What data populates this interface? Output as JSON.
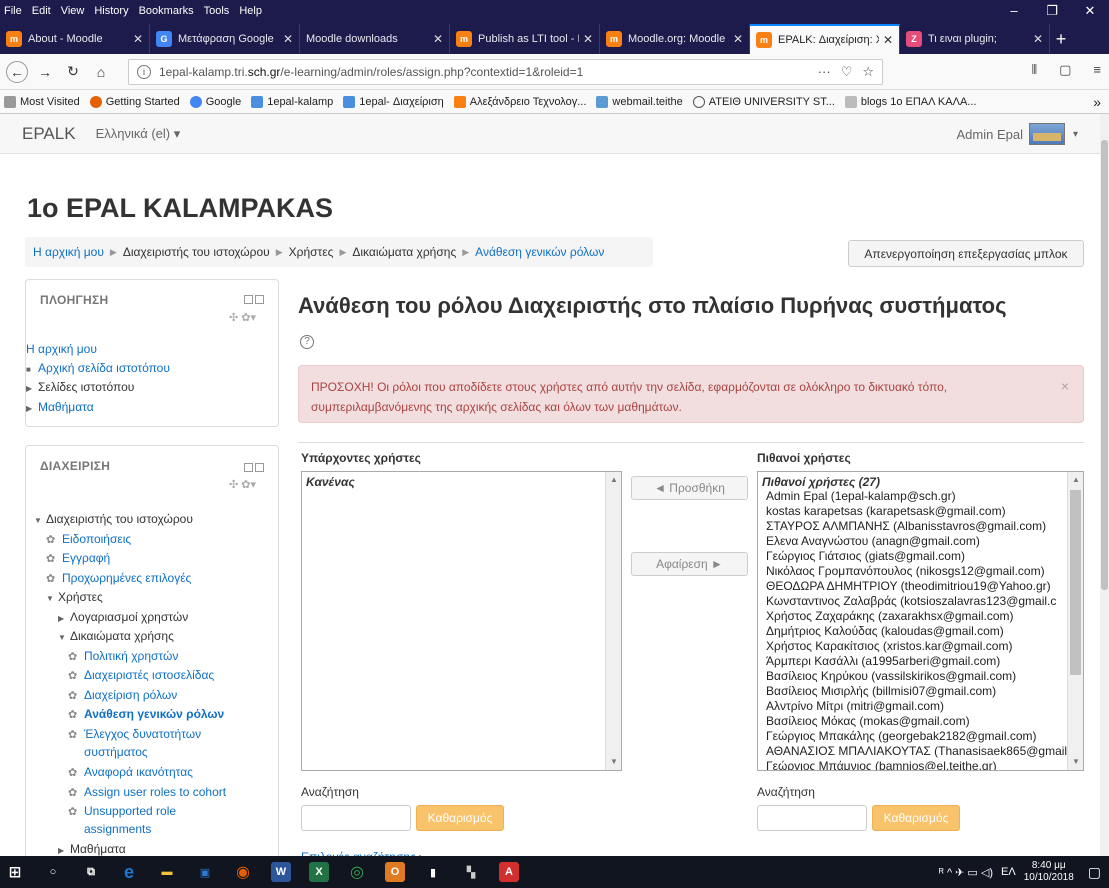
{
  "browser": {
    "menu": [
      "File",
      "Edit",
      "View",
      "History",
      "Bookmarks",
      "Tools",
      "Help"
    ],
    "window_controls": [
      "–",
      "❐",
      "✕"
    ],
    "tabs": [
      {
        "label": "About - Moodle",
        "color": "#f98012",
        "glyph": "m"
      },
      {
        "label": "Μετάφραση Google",
        "color": "#4285f4",
        "glyph": "G"
      },
      {
        "label": "Moodle downloads",
        "color": "",
        "glyph": ""
      },
      {
        "label": "Publish as LTI tool - M",
        "color": "#f98012",
        "glyph": "m"
      },
      {
        "label": "Moodle.org: Moodle S",
        "color": "#f98012",
        "glyph": "m"
      },
      {
        "label": "EPALK: Διαχείριση: Χρ",
        "color": "#f98012",
        "glyph": "m"
      },
      {
        "label": "Τι ειναι plugin;",
        "color": "#e44d7a",
        "glyph": "Z"
      }
    ],
    "new_tab": "+",
    "url_host": "1epal-kalamp.tri.",
    "url_domain": "sch.gr",
    "url_path": "/e-learning/admin/roles/assign.php?contextid=1&roleid=1",
    "url_icons": [
      "···",
      "♡",
      "☆"
    ],
    "nav_right_icons": [
      "⫴",
      "▢",
      "≡"
    ],
    "bookmarks": [
      {
        "label": "Most Visited",
        "color": "#999"
      },
      {
        "label": "Getting Started",
        "color": "#e66000"
      },
      {
        "label": "Google",
        "color": "#4285f4"
      },
      {
        "label": "1epal-kalamp",
        "color": "#4a8ee0"
      },
      {
        "label": "1epal- Διαχείριση",
        "color": "#4a8ee0"
      },
      {
        "label": "Αλεξάνδρειο Τεχνολογ...",
        "color": "#f98012"
      },
      {
        "label": "webmail.teithe",
        "color": "#5b9bd5"
      },
      {
        "label": "ΑΤΕΙΘ UNIVERSITY ST...",
        "color": "#555"
      },
      {
        "label": "blogs 1ο ΕΠΑΛ ΚΑΛΑ...",
        "color": "#bbb"
      }
    ],
    "bookmarks_more": "»"
  },
  "moodle": {
    "brand": "EPALK",
    "language": "Ελληνικά (el) ▾",
    "user_name": "Admin Epal",
    "user_caret": "▾",
    "site_title": "1ο EPAL KALAMPAKAS",
    "breadcrumb": [
      "Η αρχική μου",
      "Διαχειριστής του ιστοχώρου",
      "Χρήστες",
      "Δικαιώματα χρήσης",
      "Ανάθεση γενικών ρόλων"
    ],
    "breadcrumb_sep": "▶",
    "block_editing_button": "Απενεργοποίηση επεξεργασίας μπλοκ",
    "navigation_block": {
      "title": "ΠΛΟΗΓΗΣΗ",
      "controls": "✣ ✿▾",
      "items": [
        {
          "label": "Η αρχική μου"
        },
        {
          "label": "Αρχική σελίδα ιστοτόπου"
        },
        {
          "label": "Σελίδες ιστοτόπου"
        },
        {
          "label": "Μαθήματα"
        }
      ]
    },
    "admin_block": {
      "title": "ΔΙΑΧΕΙΡΙΣΗ",
      "controls": "✣ ✿▾",
      "items": [
        {
          "label": "Διαχειριστής του ιστοχώρου"
        },
        {
          "label": "Ειδοποιήσεις"
        },
        {
          "label": "Εγγραφή"
        },
        {
          "label": "Προχωρημένες επιλογές"
        },
        {
          "label": "Χρήστες"
        },
        {
          "label": "Λογαριασμοί χρηστών"
        },
        {
          "label": "Δικαιώματα χρήσης"
        },
        {
          "label": "Πολιτική χρηστών"
        },
        {
          "label": "Διαχειριστές ιστοσελίδας"
        },
        {
          "label": "Διαχείριση ρόλων"
        },
        {
          "label": "Ανάθεση γενικών ρόλων"
        },
        {
          "label": "Έλεγχος δυνατοτήτων"
        },
        {
          "label": "συστήματος"
        },
        {
          "label": "Αναφορά ικανότητας"
        },
        {
          "label": "Assign user roles to cohort"
        },
        {
          "label": "Unsupported role"
        },
        {
          "label": "assignments"
        },
        {
          "label": "Μαθήματα"
        }
      ]
    },
    "page_heading": "Ανάθεση του ρόλου Διαχειριστής στο πλαίσιο Πυρήνας συστήματος",
    "help_glyph": "?",
    "alert_text": "ΠΡΟΣΟΧΗ! Οι ρόλοι που αποδίδετε στους χρήστες από αυτήν την σελίδα, εφαρμόζονται σε ολόκληρο το δικτυακό τόπο, συμπεριλαμβανόμενης της αρχικής σελίδας και όλων των μαθημάτων.",
    "alert_close": "×",
    "existing_users": {
      "heading": "Υπάρχοντες χρήστες",
      "group_label": "Κανένας"
    },
    "add_button": "◄ Προσθήκη",
    "remove_button": "Αφαίρεση ►",
    "potential_users": {
      "heading": "Πιθανοί χρήστες",
      "group_label": "Πιθανοί χρήστες (27)",
      "users": [
        "Admin Epal (1epal-kalamp@sch.gr)",
        "kostas karapetsas (karapetsask@gmail.com)",
        "ΣΤΑΥΡΟΣ ΑΛΜΠΑΝΗΣ (Albanisstavros@gmail.com)",
        "Ελενα Αναγνώστου (anagn@gmail.com)",
        "Γεώργιος Γιάτσιος (giats@gmail.com)",
        "Νικόλαος Γρομπανόπουλος (nikosgs12@gmail.com)",
        "ΘΕΟΔΩΡΑ ΔΗΜΗΤΡΙΟΥ (theodimitriou19@Yahoo.gr)",
        "Κωνσταντινος Ζαλαβράς (kotsioszalavras123@gmail.c",
        "Χρήστος Ζαχαράκης (zaxarakhsx@gmail.com)",
        "Δημήτριος Καλούδας (kaloudas@gmail.com)",
        "Χρήστος Καρακίτσιος (xristos.kar@gmail.com)",
        "Άρμπερι Κασάλλι (a1995arberi@gmail.com)",
        "Βασίλειος Κηρύκου (vassilskirikos@gmail.com)",
        "Βασίλειος Μισιρλής (billmisi07@gmail.com)",
        "Αλντρίνο Μίτρι (mitri@gmail.com)",
        "Βασίλειος Μόκας (mokas@gmail.com)",
        "Γεώργιος Μπακάλης (georgebak2182@gmail.com)",
        "ΑΘΑΝΑΣΙΟΣ ΜΠΑΛΙΑΚΟΥΤΑΣ (Thanasisaek865@gmail.",
        "Γεώργιος Μπάμνιος (bamnios@el.teithe.gr)"
      ]
    },
    "search_label": "Αναζήτηση",
    "clear_button": "Καθαρισμός",
    "search_options": "Επιλογές αναζήτησης ▸"
  },
  "taskbar": {
    "clock_time": "8:40 μμ",
    "clock_date": "10/10/2018",
    "lang_indicator": "ΕΛ",
    "tray_icons": "ᴿ ^ ✈ ▭ ◁)",
    "notify_glyph": "▢",
    "apps": [
      {
        "name": "windows-start-icon",
        "glyph": "⊞",
        "color": ""
      },
      {
        "name": "search-icon",
        "glyph": "○",
        "color": ""
      },
      {
        "name": "task-view-icon",
        "glyph": "⧉",
        "color": ""
      },
      {
        "name": "edge-icon",
        "glyph": "e",
        "color": "#1f77d0"
      },
      {
        "name": "file-explorer-icon",
        "glyph": "▬",
        "color": "#f3c33a"
      },
      {
        "name": "store-icon",
        "glyph": "▣",
        "color": "#2b7bd3"
      },
      {
        "name": "firefox-icon",
        "glyph": "◉",
        "color": "#e66000"
      },
      {
        "name": "word-icon",
        "glyph": "W",
        "color": "#2b579a"
      },
      {
        "name": "excel-icon",
        "glyph": "X",
        "color": "#217346"
      },
      {
        "name": "chrome-icon",
        "glyph": "◎",
        "color": "#34a853"
      },
      {
        "name": "outlook-icon",
        "glyph": "O",
        "color": "#e07b24"
      },
      {
        "name": "document-icon",
        "glyph": "▮",
        "color": "#ffffff"
      },
      {
        "name": "app-icon",
        "glyph": "▚",
        "color": "#cccccc"
      },
      {
        "name": "acrobat-icon",
        "glyph": "A",
        "color": "#d32f2f"
      }
    ]
  },
  "colors": {
    "link": "#0f6fc5",
    "alert_bg": "#f2dede",
    "alert_text": "#a94442",
    "clear_button": "#f9c36b",
    "browser_chrome": "#1c1b4b"
  }
}
